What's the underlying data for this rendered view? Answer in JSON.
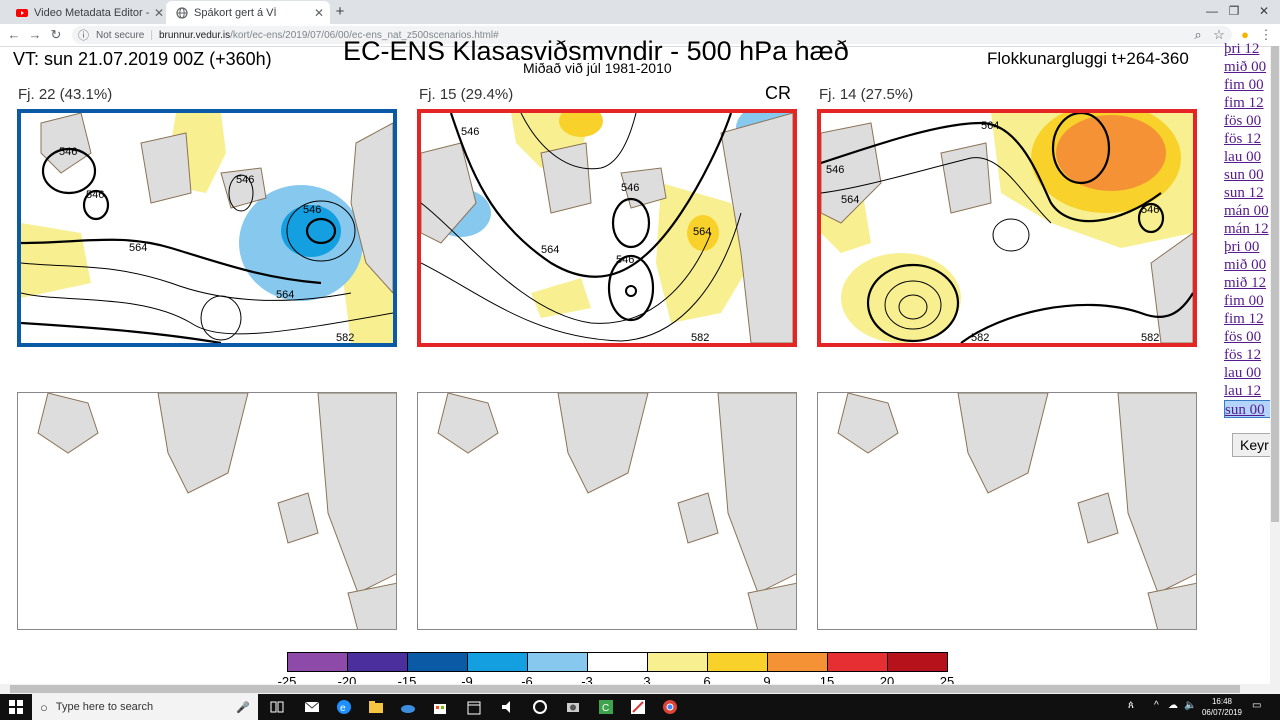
{
  "browser": {
    "tabs": [
      {
        "title": "Video Metadata Editor - YouTube",
        "active": false
      },
      {
        "title": "Spákort gert á VÍ",
        "active": true
      }
    ],
    "address": {
      "security": "Not secure",
      "host": "brunnur.vedur.is",
      "path": "/kort/ec-ens/2019/07/06/00/ec-ens_nat_z500scenarios.html#"
    }
  },
  "page": {
    "title": "EC-ENS Klasasviðsmyndir - 500 hPa hæð",
    "vt": "VT: sun 21.07.2019 00Z  (+360h)",
    "subtitle": "Miðað við júl 1981-2010",
    "window": "Flokkunargluggi t+264-360",
    "cr": "CR",
    "panels": [
      {
        "label": "Fj. 22 (43.1%)",
        "frame_color": "#0a5aa5"
      },
      {
        "label": "Fj. 15 (29.4%)",
        "frame_color": "#e52525"
      },
      {
        "label": "Fj. 14 (27.5%)",
        "frame_color": "#e52525"
      }
    ],
    "contour_labels": {
      "p1": [
        "546",
        "546",
        "546",
        "546",
        "564",
        "564",
        "582"
      ],
      "p2": [
        "546",
        "546",
        "546",
        "564",
        "564",
        "582"
      ],
      "p3": [
        "546",
        "564",
        "564",
        "546",
        "582",
        "582"
      ]
    }
  },
  "colorbar": {
    "colors": [
      "#8e4aa8",
      "#4b2f9c",
      "#0a5aa5",
      "#14a0e0",
      "#86c8ee",
      "#ffffff",
      "#f8f090",
      "#f8d22a",
      "#f59236",
      "#e52f32",
      "#b5121b"
    ],
    "labels": [
      "-25",
      "-20",
      "-15",
      "-9",
      "-6",
      "-3",
      "3",
      "6",
      "9",
      "15",
      "20",
      "25"
    ]
  },
  "dates": [
    "þri 12",
    "mið 00",
    "fim 00",
    "fim 12",
    "fös 00",
    "fös 12",
    "lau 00",
    "sun 00",
    "sun 12",
    "mán 00",
    "mán 12",
    "þri 00",
    "mið 00",
    "mið 12",
    "fim 00",
    "fim 12",
    "fös 00",
    "fös 12",
    "lau 00",
    "lau 12",
    "sun 00"
  ],
  "selected_date_index": 20,
  "keyr_label": "Keyr",
  "taskbar": {
    "search_placeholder": "Type here to search",
    "time": "16:48",
    "date": "06/07/2019"
  }
}
